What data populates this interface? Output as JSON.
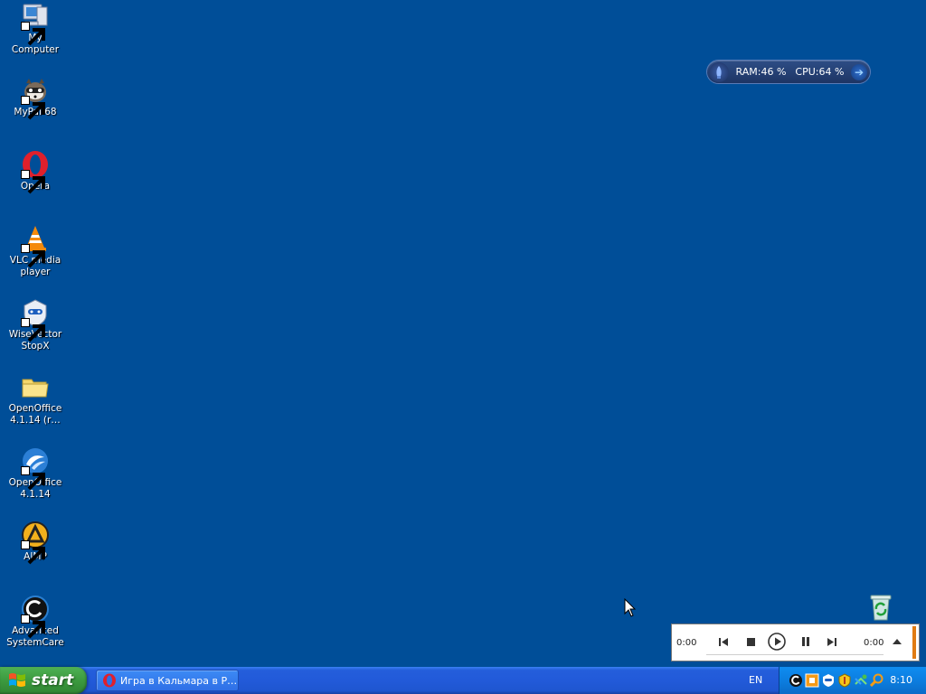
{
  "desktop": {
    "background": "#004e98",
    "icons": [
      {
        "label": "My Computer",
        "icon": "my-computer-icon"
      },
      {
        "label": "MyPal 68",
        "icon": "mypal-icon"
      },
      {
        "label": "Opera",
        "icon": "opera-icon"
      },
      {
        "label": "VLC media\nplayer",
        "icon": "vlc-icon"
      },
      {
        "label": "WiseVector\nStopX",
        "icon": "wisevector-icon"
      },
      {
        "label": "OpenOffice\n4.1.14 (r…",
        "icon": "folder-icon"
      },
      {
        "label": "OpenOffice\n4.1.14",
        "icon": "openoffice-icon"
      },
      {
        "label": "AIMP",
        "icon": "aimp-icon"
      },
      {
        "label": "Advanced\nSystemCare",
        "icon": "advanced-systemcare-icon"
      }
    ]
  },
  "gadget": {
    "ram": "RAM:46 %",
    "cpu": "CPU:64 %"
  },
  "player": {
    "time_left": "0:00",
    "time_right": "0:00"
  },
  "taskbar": {
    "start_label": "start",
    "task_title": "Игра в Кальмара в Р…",
    "language": "EN",
    "clock": "8:10"
  },
  "colors": {
    "desktop": "#004e98",
    "taskbar": "#245edb",
    "start_button": "#3c9a3f",
    "tray": "#0c7ee0"
  }
}
